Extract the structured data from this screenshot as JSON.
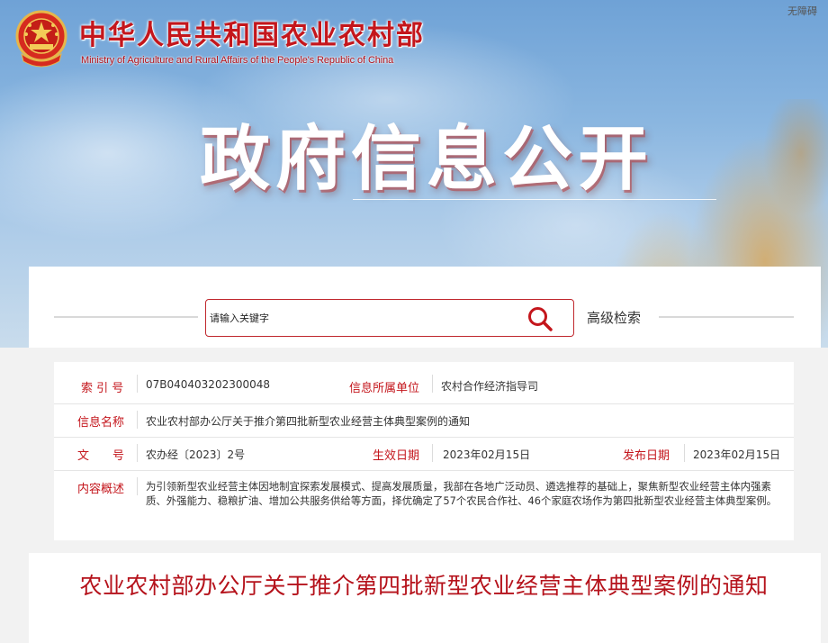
{
  "header": {
    "ministry_cn": "中华人民共和国农业农村部",
    "ministry_en": "Ministry of Agriculture and Rural Affairs of the People's Republic of China",
    "accessibility": "无障碍",
    "banner_title": "政府信息公开",
    "emblem_icon": "national-emblem-icon"
  },
  "search": {
    "placeholder": "请输入关键字",
    "advanced_label": "高级检索",
    "icon": "search-icon"
  },
  "info": {
    "index_label": "索 引 号",
    "index_value": "07B040403202300048",
    "unit_label": "信息所属单位",
    "unit_value": "农村合作经济指导司",
    "name_label": "信息名称",
    "name_value": "农业农村部办公厅关于推介第四批新型农业经营主体典型案例的通知",
    "doc_label": "文　　号",
    "doc_value": "农办经〔2023〕2号",
    "effective_label": "生效日期",
    "effective_value": "2023年02月15日",
    "publish_label": "发布日期",
    "publish_value": "2023年02月15日",
    "summary_label": "内容概述",
    "summary_value": "为引领新型农业经营主体因地制宜探索发展模式、提高发展质量，我部在各地广泛动员、遴选推荐的基础上，聚焦新型农业经营主体内强素质、外强能力、稳粮扩油、增加公共服务供给等方面，择优确定了57个农民合作社、46个家庭农场作为第四批新型农业经营主体典型案例。"
  },
  "article": {
    "title": "农业农村部办公厅关于推介第四批新型农业经营主体典型案例的通知"
  },
  "colors": {
    "brand_red": "#c4161c",
    "title_red": "#b5121b"
  }
}
